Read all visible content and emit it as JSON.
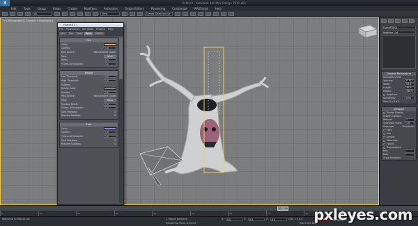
{
  "window": {
    "title": "Untitled - Autodesk 3ds Max Design 2011 x64"
  },
  "menu": [
    "Edit",
    "Tools",
    "Group",
    "Views",
    "Create",
    "Modifiers",
    "Animation",
    "Graph Editors",
    "Rendering",
    "Customize",
    "MAXScript",
    "Help"
  ],
  "toolbar": {
    "selection_filter": "All",
    "view_label": "View",
    "selection_set": "Create Selection Se"
  },
  "viewport": {
    "label": "[+] [Perspective] [ Smooth + Highlights ]"
  },
  "dialog": {
    "title": "FumeFX 2.1",
    "menu": [
      "File",
      "Preferences",
      "Sim Mode",
      "Preview",
      "Help"
    ],
    "tabs": [
      "Gen",
      "Sim",
      "Illum",
      "Rend",
      "Obj/Src"
    ],
    "active_tab": "Rend",
    "fire": {
      "header": "Fire",
      "color_label": "Color:",
      "color_value": "#e8a45a",
      "opacity_label": "Opacity:",
      "opacity_value": "1.0",
      "map_source_label": "Map Source:",
      "map_source_value": "World/Object Coords",
      "map_label": "Map:",
      "map_value": "None",
      "alpha_label": "Alpha",
      "alpha_value": "0.0",
      "mult_label": "Y Sens GI Multiplier:",
      "mult_value": "1.0"
    },
    "smoke": {
      "header": "Smoke",
      "low_label": "Low Threshold:",
      "low_value": "0.0",
      "high_label": "High Threshold:",
      "high_value": "1.0",
      "isolated_label": "Isolated",
      "smoke_color_label": "Smoke Color:",
      "smoke_color": "#8a8a8a",
      "opacity_label": "Opacity:",
      "opacity_value": "1.0",
      "map_source_label": "Map Source:",
      "map_source_value": "World/Object Coords",
      "map_label": "Map:",
      "map_value": "None",
      "shadow_label": "Shadow Falloff:",
      "shadow_value": "1.0",
      "mult_label": "Y Sens GI Multiplier:",
      "mult_value": "1.0",
      "cast_label": "Cast Shadows",
      "receive_label": "Receive Shadows"
    },
    "fuel": {
      "header": "Fuel",
      "color_label": "Color:",
      "color_value": "#8c8ce8",
      "opacity_label": "Opacity:",
      "opacity_value": "1.0",
      "mult_label": "Y Sens GI Multiplier:",
      "mult_value": "1.0",
      "cast_label": "Cast Shadows",
      "receive_label": "Receive Shadows"
    }
  },
  "command_panel": {
    "object_name": "FumeFX001",
    "modifier_list": "Modifier List",
    "rollout1": "General Parameters",
    "sim_label": "Simulation Area",
    "spacing_label": "Spacing:",
    "spacing_value": "0.722",
    "width_label": "Width:",
    "width_value": "54.0",
    "length_label": "Length:",
    "length_value": "46.0",
    "height_label": "Height:",
    "height_value": "180.0",
    "adaptive_label": "Adaptive:",
    "sensitivity_label": "Sensitivity:",
    "sensitivity_value": "0.01",
    "size_label": "Size: 0 x 0 x 0",
    "rollout2": "Viewport",
    "disable_label": "Enable Display",
    "display_label": "Display Options",
    "reduce_label": "Reduce:",
    "reduce_value": "1",
    "threshold_label": "Threshold Scale:",
    "threshold_value": "1.0",
    "channels_label": "Channels",
    "thresholds_label": "Thresholds",
    "channel_items": [
      "Fuel",
      "Fire",
      "Smoke",
      "Velocities",
      "Forces",
      "Temperature"
    ],
    "min_label": "Min:",
    "max_label": "Max:",
    "scale_label": "Scale Multiplier"
  },
  "timeline": {
    "frame": "30 / 100",
    "ticks": [
      "0",
      "10",
      "20",
      "30",
      "40",
      "50",
      "60",
      "70",
      "80",
      "90",
      "100"
    ]
  },
  "status": {
    "objects": "1 Object Selected",
    "prompt": "Welcome to MAXScript.",
    "render_time": "Rendering Time: 0:00:12",
    "x_label": "X:",
    "x_value": "0.0",
    "y_label": "Y:",
    "y_value": "0.0",
    "z_label": "Z:",
    "z_value": "0.0",
    "grid_label": "Grid = 10.0",
    "auto_key": "Auto Key",
    "add_time_tag": "Add Time Tag",
    "selected_label": "Selected"
  },
  "watermark": "pxleyes.com"
}
